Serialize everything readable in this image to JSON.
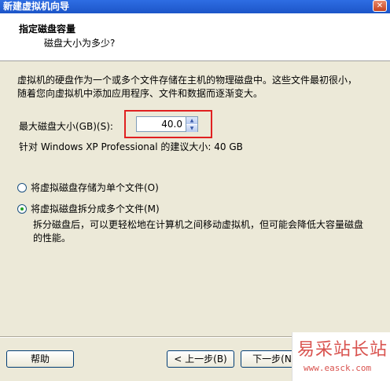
{
  "window": {
    "title": "新建虚拟机向导",
    "close_glyph": "✕"
  },
  "header": {
    "title": "指定磁盘容量",
    "subtitle": "磁盘大小为多少?"
  },
  "description": "虚拟机的硬盘作为一个或多个文件存储在主机的物理磁盘中。这些文件最初很小，随着您向虚拟机中添加应用程序、文件和数据而逐渐变大。",
  "disk_size": {
    "label": "最大磁盘大小(GB)(S):",
    "value": "40.0",
    "recommended": "针对 Windows XP Professional 的建议大小: 40 GB"
  },
  "options": {
    "single_file": {
      "label": "将虚拟磁盘存储为单个文件(O)",
      "checked": false
    },
    "multiple_files": {
      "label": "将虚拟磁盘拆分成多个文件(M)",
      "checked": true
    },
    "multiple_files_desc": "拆分磁盘后，可以更轻松地在计算机之间移动虚拟机，但可能会降低大容量磁盘的性能。"
  },
  "buttons": {
    "help": "帮助",
    "back": "< 上一步(B)",
    "next": "下一步(N"
  },
  "watermark": {
    "main": "易采站长站",
    "url": "www.easck.com"
  },
  "colors": {
    "titlebar": "#1c55c8",
    "highlight_border": "#e02020",
    "watermark": "#d9534f",
    "dialog_bg": "#ece9d8"
  }
}
